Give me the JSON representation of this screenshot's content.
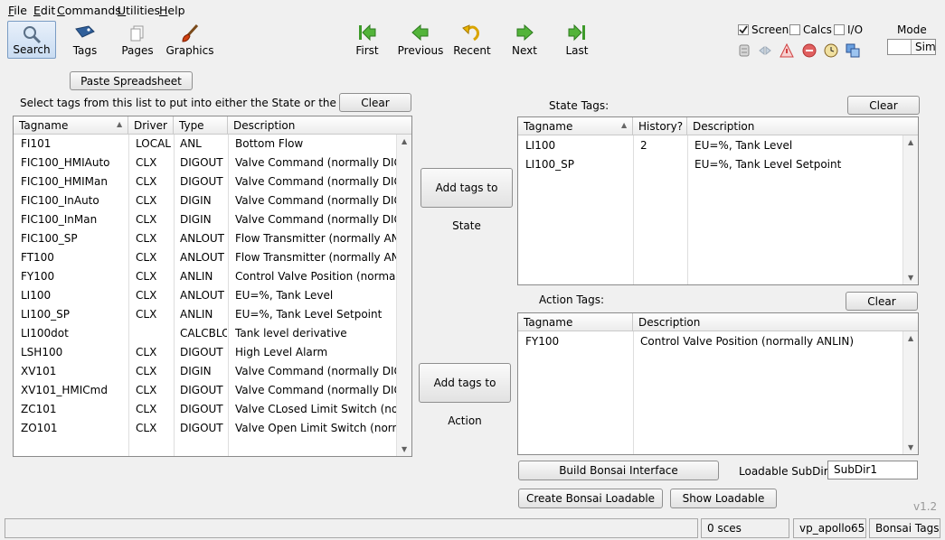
{
  "menu": [
    "File",
    "Edit",
    "Commands",
    "Utilities",
    "Help"
  ],
  "toolbar": {
    "search": "Search",
    "tags": "Tags",
    "pages": "Pages",
    "graphics": "Graphics",
    "first": "First",
    "previous": "Previous",
    "recent": "Recent",
    "next": "Next",
    "last": "Last"
  },
  "options": {
    "screen": "Screen",
    "calcs": "Calcs",
    "io": "I/O",
    "mode": "Mode",
    "sim": "Sim",
    "screen_checked": true
  },
  "left": {
    "paste_label": "Paste Spreadsheet",
    "instruction": "Select tags from this list to put into either the State or the Action",
    "clear_label": "Clear",
    "columns": [
      "Tagname",
      "Driver",
      "Type",
      "Description"
    ],
    "rows": [
      [
        "FI101",
        "LOCAL",
        "ANL",
        "Bottom Flow"
      ],
      [
        "FIC100_HMIAuto",
        "CLX",
        "DIGOUT",
        "Valve Command (normally DIGIN"
      ],
      [
        "FIC100_HMIMan",
        "CLX",
        "DIGOUT",
        "Valve Command (normally DIGIN"
      ],
      [
        "FIC100_InAuto",
        "CLX",
        "DIGIN",
        "Valve Command (normally DIGIN"
      ],
      [
        "FIC100_InMan",
        "CLX",
        "DIGIN",
        "Valve Command (normally DIGIN"
      ],
      [
        "FIC100_SP",
        "CLX",
        "ANLOUT",
        "Flow Transmitter (normally ANLO"
      ],
      [
        "FT100",
        "CLX",
        "ANLOUT",
        "Flow Transmitter (normally ANLO"
      ],
      [
        "FY100",
        "CLX",
        "ANLIN",
        "Control Valve Position (normally"
      ],
      [
        "LI100",
        "CLX",
        "ANLOUT",
        "EU=%, Tank Level"
      ],
      [
        "LI100_SP",
        "CLX",
        "ANLIN",
        "EU=%, Tank Level Setpoint"
      ],
      [
        "LI100dot",
        "",
        "CALCBLO",
        "Tank level derivative"
      ],
      [
        "LSH100",
        "CLX",
        "DIGOUT",
        "High Level Alarm"
      ],
      [
        "XV101",
        "CLX",
        "DIGIN",
        "Valve Command (normally DIGIN"
      ],
      [
        "XV101_HMICmd",
        "CLX",
        "DIGOUT",
        "Valve Command (normally DIGIN"
      ],
      [
        "ZC101",
        "CLX",
        "DIGOUT",
        "Valve CLosed Limit Switch (norm"
      ],
      [
        "ZO101",
        "CLX",
        "DIGOUT",
        "Valve Open Limit Switch (normal"
      ]
    ]
  },
  "middle": {
    "add_state": "Add tags to State",
    "add_action": "Add tags to Action"
  },
  "state": {
    "label": "State Tags:",
    "clear_label": "Clear",
    "columns": [
      "Tagname",
      "History?",
      "Description"
    ],
    "rows": [
      [
        "LI100",
        "2",
        "EU=%, Tank Level"
      ],
      [
        "LI100_SP",
        "",
        "EU=%, Tank Level Setpoint"
      ]
    ]
  },
  "action": {
    "label": "Action Tags:",
    "clear_label": "Clear",
    "columns": [
      "Tagname",
      "Description"
    ],
    "rows": [
      [
        "FY100",
        "Control Valve Position (normally ANLIN)"
      ]
    ]
  },
  "bottom": {
    "build": "Build Bonsai Interface",
    "subdir_label": "Loadable SubDir:",
    "subdir_value": "SubDir1",
    "create": "Create Bonsai Loadable",
    "show": "Show Loadable",
    "version": "v1.2"
  },
  "statusbar": {
    "count": "0 sces",
    "host": "vp_apollo65",
    "view": "Bonsai Tags"
  }
}
